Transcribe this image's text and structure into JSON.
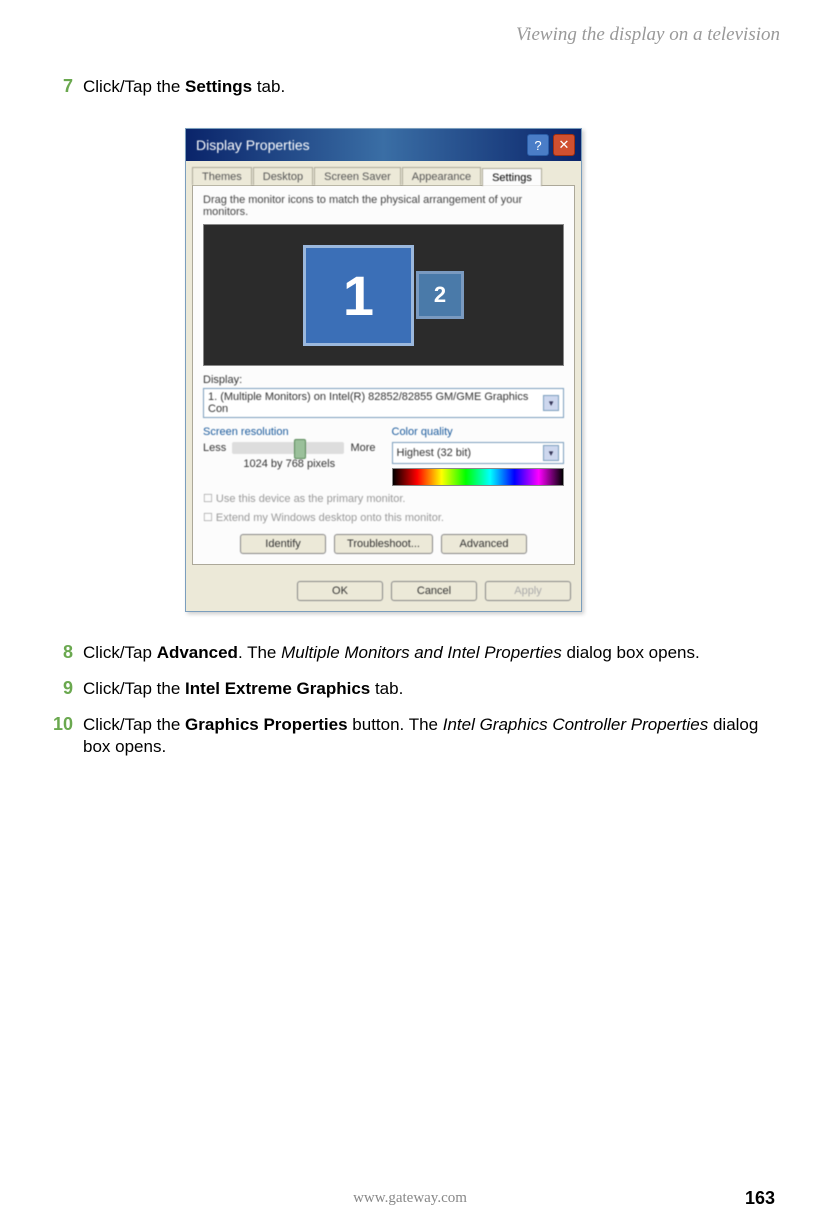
{
  "header": "Viewing the display on a television",
  "steps": {
    "7": {
      "num": "7",
      "pre": "Click/Tap the ",
      "bold": "Settings",
      "post": " tab."
    },
    "8": {
      "num": "8",
      "pre": "Click/Tap ",
      "bold": "Advanced",
      "mid": ". The ",
      "italic": "Multiple Monitors and Intel Properties",
      "post": " dialog box opens."
    },
    "9": {
      "num": "9",
      "pre": "Click/Tap the ",
      "bold": "Intel Extreme Graphics",
      "post": " tab."
    },
    "10": {
      "num": "10",
      "pre": "Click/Tap the ",
      "bold": "Graphics Properties",
      "mid": " button. The ",
      "italic": "Intel Graphics Controller Properties",
      "post": " dialog box opens."
    }
  },
  "dialog": {
    "title": "Display Properties",
    "help_icon": "?",
    "close_icon": "✕",
    "tabs": [
      "Themes",
      "Desktop",
      "Screen Saver",
      "Appearance",
      "Settings"
    ],
    "active_tab_index": 4,
    "drag_text": "Drag the monitor icons to match the physical arrangement of your monitors.",
    "mon1": "1",
    "mon2": "2",
    "display_label": "Display:",
    "display_value": "1. (Multiple Monitors) on Intel(R) 82852/82855 GM/GME Graphics Con",
    "sr_label": "Screen resolution",
    "sr_less": "Less",
    "sr_more": "More",
    "sr_value": "1024 by 768 pixels",
    "cq_label": "Color quality",
    "cq_value": "Highest (32 bit)",
    "chk1": "Use this device as the primary monitor.",
    "chk2": "Extend my Windows desktop onto this monitor.",
    "identify": "Identify",
    "troubleshoot": "Troubleshoot...",
    "advanced": "Advanced",
    "ok": "OK",
    "cancel": "Cancel",
    "apply": "Apply"
  },
  "footer": {
    "url": "www.gateway.com",
    "page": "163"
  }
}
